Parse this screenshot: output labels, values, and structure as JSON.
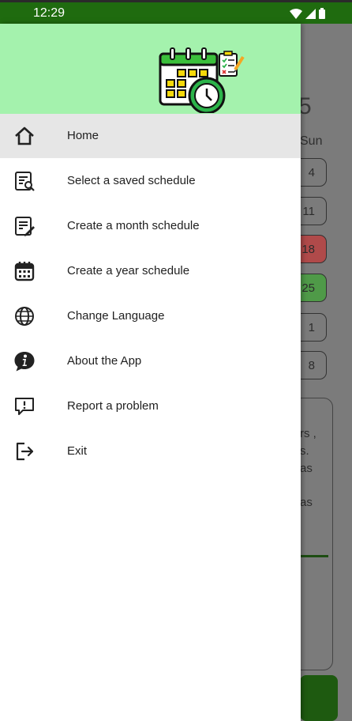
{
  "status_bar": {
    "time": "12:29"
  },
  "background_screen": {
    "header_fragment": "5",
    "day_name": "Sun",
    "day_numbers": [
      "4",
      "11",
      "18",
      "25",
      "1",
      "8"
    ],
    "card_fragments": [
      "rs ,",
      "s.",
      "as",
      "as"
    ]
  },
  "drawer": {
    "menu": [
      {
        "label": "Home",
        "icon": "home-icon",
        "active": true
      },
      {
        "label": "Select a saved schedule",
        "icon": "search-list-icon",
        "active": false
      },
      {
        "label": "Create a month schedule",
        "icon": "edit-list-icon",
        "active": false
      },
      {
        "label": "Create a year schedule",
        "icon": "calendar-icon",
        "active": false
      },
      {
        "label": "Change Language",
        "icon": "globe-icon",
        "active": false
      },
      {
        "label": "About the App",
        "icon": "info-icon",
        "active": false
      },
      {
        "label": "Report a problem",
        "icon": "report-icon",
        "active": false
      },
      {
        "label": "Exit",
        "icon": "exit-icon",
        "active": false
      }
    ]
  },
  "colors": {
    "status_bar": "#1f6b0f",
    "drawer_header": "#a4f2ad",
    "active_item": "#e6e6e6",
    "highlight_red": "#b04a4a",
    "highlight_green": "#4f9a48"
  }
}
